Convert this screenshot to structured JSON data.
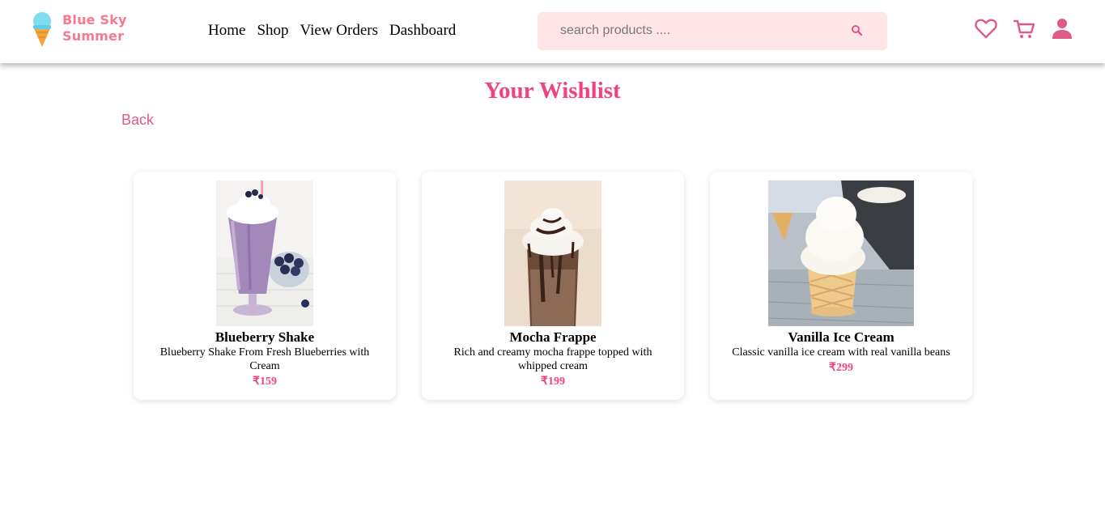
{
  "brand": {
    "line1": "Blue Sky",
    "line2": "Summer"
  },
  "nav": {
    "links": [
      "Home",
      "Shop",
      "View Orders",
      "Dashboard"
    ]
  },
  "search": {
    "placeholder": "search products ...."
  },
  "icons": [
    "heart-icon",
    "cart-icon",
    "user-icon",
    "search-icon",
    "ice-cream-logo-icon"
  ],
  "colors": {
    "accent": "#f0437c",
    "brand": "#f57a8e",
    "search_bg": "#ffe4e8",
    "back": "#e05a88"
  },
  "page": {
    "title": "Your Wishlist",
    "back_label": "Back"
  },
  "products": [
    {
      "name": "Blueberry Shake",
      "description": "Blueberry Shake From Fresh Blueberries with Cream",
      "price": "₹159"
    },
    {
      "name": "Mocha Frappe",
      "description": "Rich and creamy mocha frappe topped with whipped cream",
      "price": "₹199"
    },
    {
      "name": "Vanilla Ice Cream",
      "description": "Classic vanilla ice cream with real vanilla beans",
      "price": "₹299"
    }
  ]
}
